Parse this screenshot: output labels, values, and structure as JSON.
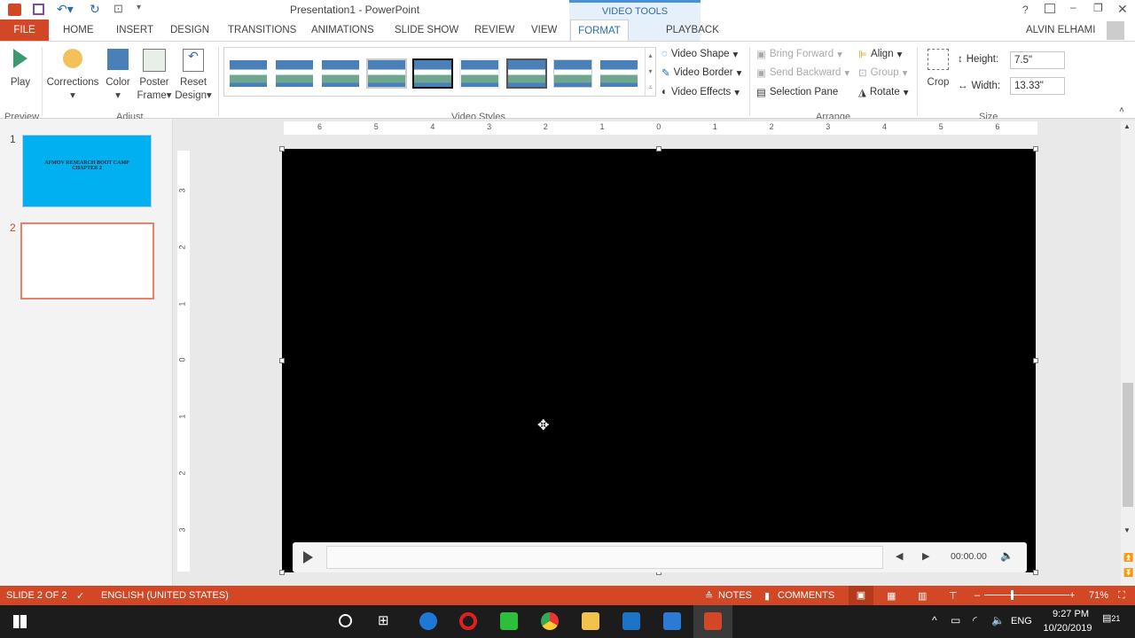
{
  "window": {
    "title": "Presentation1 - PowerPoint",
    "context_tab_group": "VIDEO TOOLS",
    "user": "ALVIN ELHAMI",
    "help": "?"
  },
  "tabs": [
    "FILE",
    "HOME",
    "INSERT",
    "DESIGN",
    "TRANSITIONS",
    "ANIMATIONS",
    "SLIDE SHOW",
    "REVIEW",
    "VIEW",
    "FORMAT",
    "PLAYBACK"
  ],
  "active_tab": "FORMAT",
  "ribbon": {
    "preview": {
      "label": "Preview",
      "play": "Play"
    },
    "adjust": {
      "label": "Adjust",
      "corrections": "Corrections",
      "color": "Color",
      "poster1": "Poster",
      "poster2": "Frame",
      "reset1": "Reset",
      "reset2": "Design"
    },
    "video_styles": {
      "label": "Video Styles",
      "shape": "Video Shape",
      "border": "Video Border",
      "effects": "Video Effects"
    },
    "arrange": {
      "label": "Arrange",
      "bring_forward": "Bring Forward",
      "send_backward": "Send Backward",
      "selection_pane": "Selection Pane",
      "align": "Align",
      "group": "Group",
      "rotate": "Rotate"
    },
    "size": {
      "label": "Size",
      "crop": "Crop",
      "height_label": "Height:",
      "height_value": "7.5\"",
      "width_label": "Width:",
      "width_value": "13.33\""
    }
  },
  "slides": [
    {
      "number": "1",
      "title": "AFMOV RESEARCH BOOT CAMP",
      "subtitle": "CHAPTER 2",
      "bg": "#00b0f0"
    },
    {
      "number": "2",
      "title": "",
      "subtitle": ""
    }
  ],
  "hruler": [
    "6",
    "5",
    "4",
    "3",
    "2",
    "1",
    "0",
    "1",
    "2",
    "3",
    "4",
    "5",
    "6"
  ],
  "vruler": [
    "3",
    "2",
    "1",
    "0",
    "1",
    "2",
    "3"
  ],
  "video": {
    "time": "00:00.00"
  },
  "status": {
    "slide": "SLIDE 2 OF 2",
    "language": "ENGLISH (UNITED STATES)",
    "notes": "NOTES",
    "comments": "COMMENTS",
    "zoom": "71%",
    "zoom_percent": 71
  },
  "taskbar": {
    "time": "9:27 PM",
    "date": "10/20/2019",
    "lang": "ENG",
    "notifications": "21"
  },
  "colors": {
    "accent": "#d24726",
    "blue": "#2a6bb3",
    "taskbar": "#1c1c1c"
  }
}
